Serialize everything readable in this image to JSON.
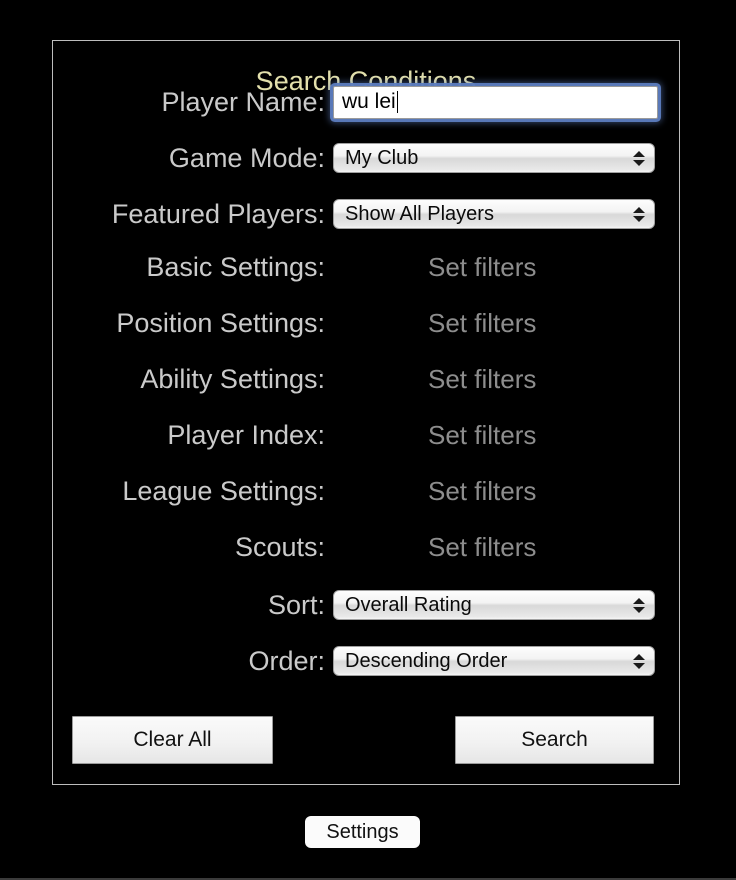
{
  "window": {
    "background_color": "#000000",
    "bottom_hairline_color": "#3b3b3b"
  },
  "groupbox": {
    "legend": "Search Conditions",
    "legend_color": "#e3e0ac",
    "border_color": "#bdbdbd"
  },
  "colors": {
    "label": "#cacaca",
    "set_filters": "#8d8d8d",
    "focus_ring": "#5c7cbe"
  },
  "rows": [
    {
      "label": "Player Name:",
      "control": "textfield",
      "value": "wu lei",
      "placeholder": ""
    },
    {
      "label": "Game Mode:",
      "control": "popup",
      "value": "My Club"
    },
    {
      "label": "Featured Players:",
      "control": "popup",
      "value": "Show All Players"
    },
    {
      "label": "Basic Settings:",
      "control": "text",
      "value": "Set filters"
    },
    {
      "label": "Position Settings:",
      "control": "text",
      "value": "Set filters"
    },
    {
      "label": "Ability Settings:",
      "control": "text",
      "value": "Set filters"
    },
    {
      "label": "Player Index:",
      "control": "text",
      "value": "Set filters"
    },
    {
      "label": "League Settings:",
      "control": "text",
      "value": "Set filters"
    },
    {
      "label": "Scouts:",
      "control": "text",
      "value": "Set filters"
    },
    {
      "label": "Sort:",
      "control": "popup",
      "value": "Overall Rating"
    },
    {
      "label": "Order:",
      "control": "popup",
      "value": "Descending Order"
    }
  ],
  "buttons": {
    "clear_all": "Clear All",
    "search": "Search",
    "settings": "Settings"
  }
}
